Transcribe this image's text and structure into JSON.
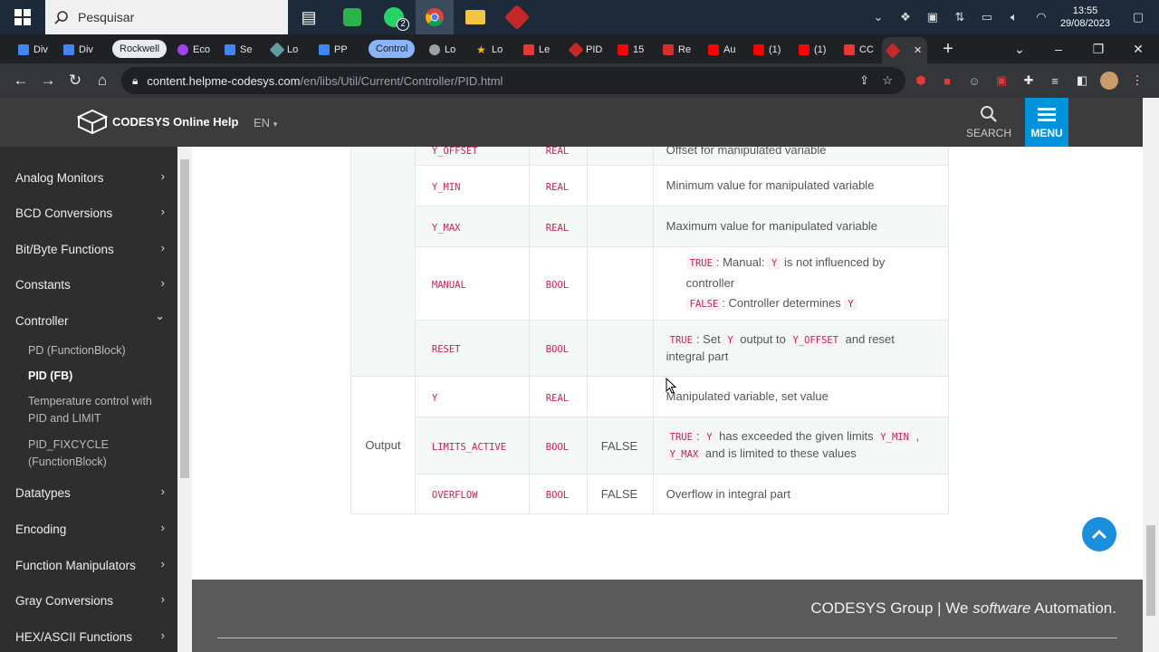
{
  "taskbar": {
    "search_placeholder": "Pesquisar",
    "whatsapp_badge": "2",
    "time": "13:55",
    "date": "29/08/2023"
  },
  "tabs": [
    {
      "label": "Div",
      "color": "#4285f4"
    },
    {
      "label": "Div",
      "color": "#4285f4"
    },
    {
      "label": "Rockwell",
      "color": "#e8eaed"
    },
    {
      "label": "Eco",
      "color": "#a142f4"
    },
    {
      "label": "Se",
      "color": "#4285f4"
    },
    {
      "label": "Lo",
      "color": "#5f9ea0"
    },
    {
      "label": "PP",
      "color": "#4285f4"
    },
    {
      "label": "Control",
      "color": "#8ab4f8"
    },
    {
      "label": "Lo",
      "color": "#9aa0a6"
    },
    {
      "label": "Lo",
      "color": "#fbbc04"
    },
    {
      "label": "Le",
      "color": "#e53935"
    },
    {
      "label": "PID",
      "color": "#c62828"
    },
    {
      "label": "15",
      "color": "#ff0000"
    },
    {
      "label": "Re",
      "color": "#d32f2f"
    },
    {
      "label": "Au",
      "color": "#ff0000"
    },
    {
      "label": "(1)",
      "color": "#ff0000"
    },
    {
      "label": "(1)",
      "color": "#ff0000"
    },
    {
      "label": "CC",
      "color": "#e53935"
    }
  ],
  "address": {
    "host": "content.helpme-codesys.com",
    "path": "/en/libs/Util/Current/Controller/PID.html"
  },
  "site": {
    "logo_text": "CODESYS Online Help",
    "lang": "EN",
    "search_label": "SEARCH",
    "menu_label": "MENU"
  },
  "sidebar": {
    "items": [
      {
        "label": "Analog Monitors",
        "chevron": "›"
      },
      {
        "label": "BCD Conversions",
        "chevron": "›"
      },
      {
        "label": "Bit/Byte Functions",
        "chevron": "›"
      },
      {
        "label": "Constants",
        "chevron": "›"
      },
      {
        "label": "Controller",
        "chevron": "⌄"
      },
      {
        "label": "Datatypes",
        "chevron": "›"
      },
      {
        "label": "Encoding",
        "chevron": "›"
      },
      {
        "label": "Function Manipulators",
        "chevron": "›"
      },
      {
        "label": "Gray Conversions",
        "chevron": "›"
      },
      {
        "label": "HEX/ASCII Functions",
        "chevron": "›"
      }
    ],
    "sub_items": [
      "PD (FunctionBlock)",
      "PID (FB)",
      "Temperature control with PID and LIMIT",
      "PID_FIXCYCLE (FunctionBlock)"
    ]
  },
  "table": {
    "rows": [
      {
        "name": "Y_OFFSET",
        "type": "REAL",
        "init": "",
        "desc": "Offset for manipulated variable"
      },
      {
        "name": "Y_MIN",
        "type": "REAL",
        "init": "",
        "desc": "Minimum value for manipulated variable"
      },
      {
        "name": "Y_MAX",
        "type": "REAL",
        "init": "",
        "desc": "Maximum value for manipulated variable"
      },
      {
        "name": "MANUAL",
        "type": "BOOL",
        "init": ""
      },
      {
        "name": "RESET",
        "type": "BOOL",
        "init": ""
      },
      {
        "name": "Y",
        "type": "REAL",
        "init": "",
        "desc": "Manipulated variable, set value"
      },
      {
        "name": "LIMITS_ACTIVE",
        "type": "BOOL",
        "init": "FALSE"
      },
      {
        "name": "OVERFLOW",
        "type": "BOOL",
        "init": "FALSE",
        "desc": "Overflow in integral part"
      }
    ],
    "output_scope": "Output",
    "manual_desc": {
      "true_code": "TRUE",
      "true_text_a": ": Manual: ",
      "y_code": "Y",
      "true_text_b": " is not influenced by controller",
      "false_code": "FALSE",
      "false_text": ": Controller determines ",
      "y_code2": "Y"
    },
    "reset_desc": {
      "true_code": "TRUE",
      "text_a": ": Set ",
      "y_code": "Y",
      "text_b": " output to ",
      "yoffset_code": "Y_OFFSET",
      "text_c": " and reset integral part"
    },
    "limits_desc": {
      "true_code": "TRUE",
      "text_a": ": ",
      "y_code": "Y",
      "text_b": " has exceeded the given limits ",
      "ymin_code": "Y_MIN",
      "text_c": " , ",
      "ymax_code": "Y_MAX",
      "text_d": " and is limited to these values"
    }
  },
  "footer": {
    "prefix": "CODESYS Group | We ",
    "emphasis": "software",
    "suffix": " Automation."
  }
}
